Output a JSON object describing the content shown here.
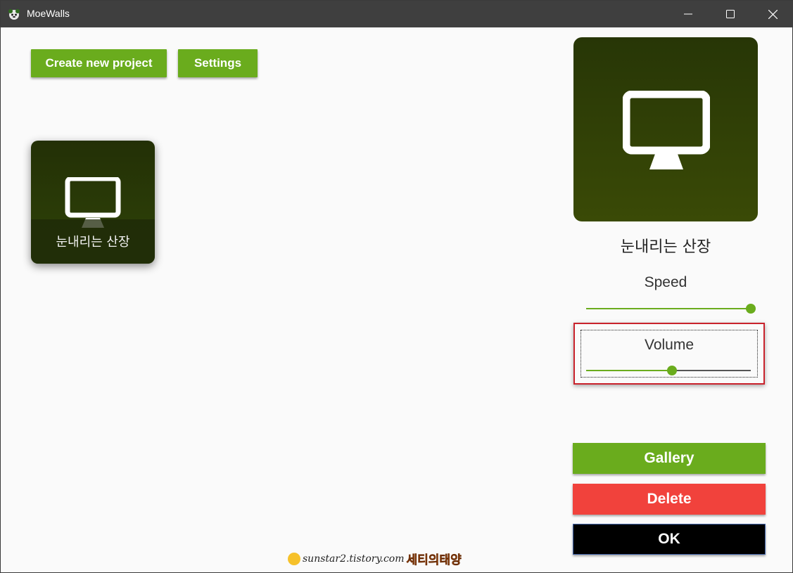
{
  "window": {
    "title": "MoeWalls",
    "icons": [
      "app-logo-icon",
      "minimize-icon",
      "maximize-icon",
      "close-icon"
    ]
  },
  "toolbar": {
    "create_label": "Create new project",
    "settings_label": "Settings"
  },
  "projects": [
    {
      "name": "눈내리는 산장",
      "icon": "monitor-icon"
    }
  ],
  "detail": {
    "name": "눈내리는 산장",
    "preview_icon": "monitor-icon",
    "speed_label": "Speed",
    "speed_value": 1.0,
    "volume_label": "Volume",
    "volume_value": 0.52
  },
  "actions": {
    "gallery_label": "Gallery",
    "delete_label": "Delete",
    "ok_label": "OK"
  },
  "watermark": {
    "site": "sunstar2.tistory.com",
    "name": "세티의태양"
  },
  "colors": {
    "accent_green": "#6aac1d",
    "delete_red": "#f1423c",
    "ok_black": "#000000",
    "highlight_red": "#c9222c",
    "titlebar": "#3f3f3f"
  }
}
